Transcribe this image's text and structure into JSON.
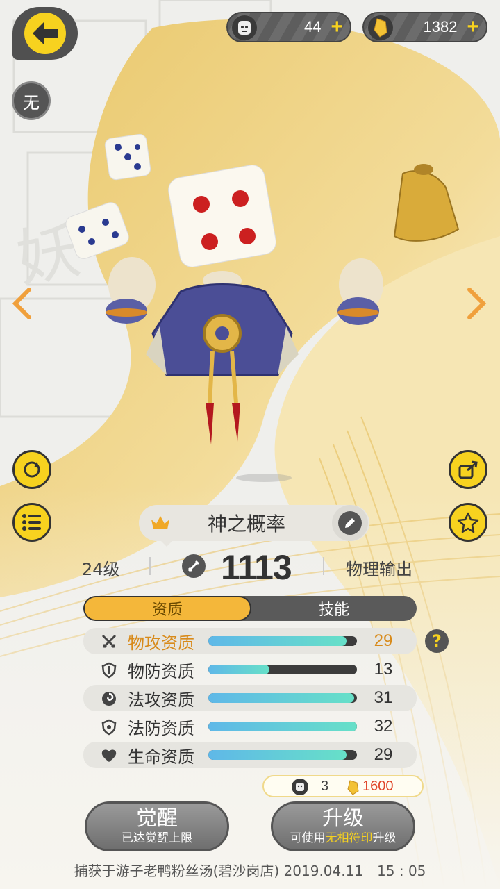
{
  "currency": {
    "ticket": {
      "icon": "face-ticket-icon",
      "value": "44"
    },
    "gold": {
      "icon": "gold-gem-icon",
      "value": "1382"
    },
    "plus": "+"
  },
  "badge": "无",
  "pet": {
    "name": "神之概率",
    "level": "24级",
    "power": "1113",
    "type": "物理输出"
  },
  "tabs": [
    "资质",
    "技能"
  ],
  "stats": [
    {
      "icon": "crossed-swords-icon",
      "label": "物攻资质",
      "value": "29",
      "fill": 0.93,
      "highlight": true
    },
    {
      "icon": "shield-icon",
      "label": "物防资质",
      "value": "13",
      "fill": 0.41,
      "highlight": false
    },
    {
      "icon": "spiral-icon",
      "label": "法攻资质",
      "value": "31",
      "fill": 0.98,
      "highlight": false
    },
    {
      "icon": "shield-icon",
      "label": "法防资质",
      "value": "32",
      "fill": 1.0,
      "highlight": false
    },
    {
      "icon": "heart-icon",
      "label": "生命资质",
      "value": "29",
      "fill": 0.93,
      "highlight": false
    }
  ],
  "help": "?",
  "cost": {
    "ticket": "3",
    "gold": "1600"
  },
  "buttons": {
    "awaken": {
      "title": "觉醒",
      "sub": "已达觉醒上限"
    },
    "upgrade": {
      "title": "升级",
      "sub_pre": "可使用",
      "sub_hl": "无相符印",
      "sub_post": "升级"
    }
  },
  "footer": "捕获于游子老鸭粉丝汤(碧沙岗店) 2019.04.11　15 : 05",
  "colors": {
    "accent": "#f7d21f",
    "highlight": "#d88a1a",
    "cost_red": "#e0462a",
    "tab_active": "#f4b73a"
  }
}
